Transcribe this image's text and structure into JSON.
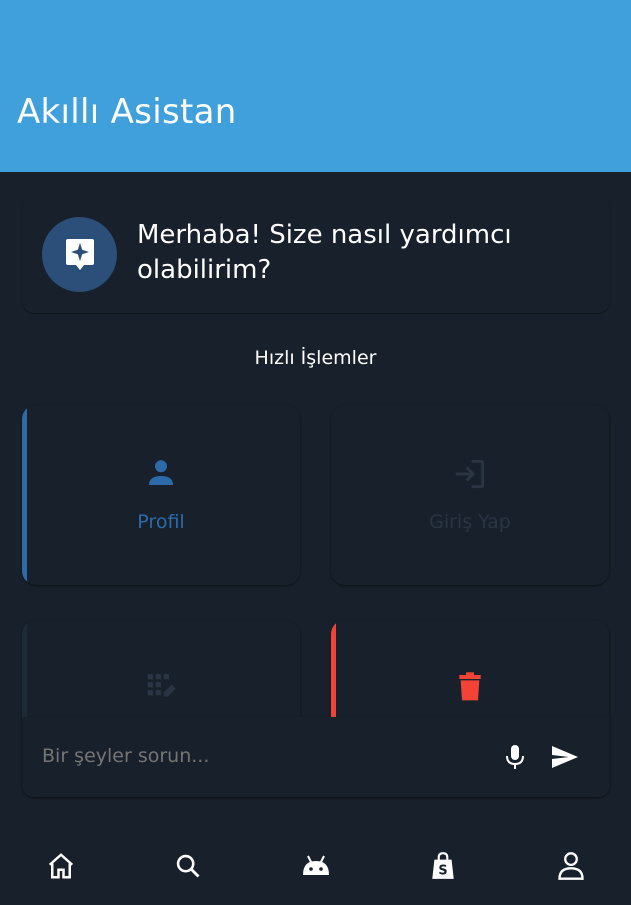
{
  "appbar": {
    "title": "Akıllı Asistan",
    "color": "#3fa0dc"
  },
  "greeting": {
    "text": "Merhaba! Size nasıl yardımcı olabilirim?",
    "icon": "sparkle-chat-icon"
  },
  "quick_actions": {
    "title": "Hızlı İşlemler",
    "items": [
      {
        "label": "Profil",
        "icon": "person-icon",
        "accent": "#2c6aa8"
      },
      {
        "label": "Giriş Yap",
        "icon": "login-icon",
        "accent": ""
      },
      {
        "label": "",
        "icon": "password-icon",
        "accent": ""
      },
      {
        "label": "",
        "icon": "trash-icon",
        "accent": "#f44336"
      }
    ]
  },
  "input": {
    "placeholder": "Bir şeyler sorun...",
    "mic_icon": "microphone-icon",
    "send_icon": "send-icon"
  },
  "bottom_nav": {
    "items": [
      {
        "icon": "home-icon"
      },
      {
        "icon": "search-icon"
      },
      {
        "icon": "android-icon"
      },
      {
        "icon": "shopping-bag-icon"
      },
      {
        "icon": "profile-icon"
      }
    ]
  }
}
